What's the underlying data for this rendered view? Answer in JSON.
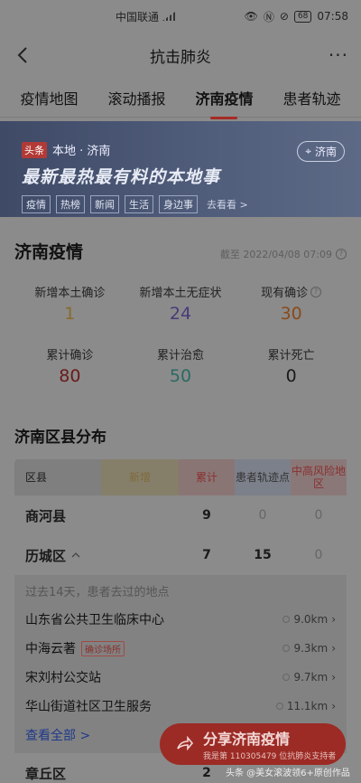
{
  "status": {
    "carrier": "中国联通",
    "time": "07:58",
    "battery": "68"
  },
  "appbar": {
    "title": "抗击肺炎"
  },
  "tabs": [
    {
      "label": "疫情地图"
    },
    {
      "label": "滚动播报"
    },
    {
      "label": "济南疫情"
    },
    {
      "label": "患者轨迹"
    }
  ],
  "banner": {
    "tag": "头条",
    "source": "本地 · 济南",
    "location": "济南",
    "headline": "最新最热最有料的本地事",
    "chips": [
      "疫情",
      "热榜",
      "新闻",
      "生活",
      "身边事"
    ],
    "goto": "去看看 >"
  },
  "summary": {
    "title": "济南疫情",
    "updated": "截至 2022/04/08 07:09",
    "stats": [
      {
        "label": "新增本土确诊",
        "value": "1",
        "color": "#8a6a2a"
      },
      {
        "label": "新增本土无症状",
        "value": "24",
        "color": "#4a3a7a"
      },
      {
        "label": "现有确诊",
        "value": "30",
        "color": "#8a4a1a"
      },
      {
        "label": "累计确诊",
        "value": "80",
        "color": "#6a1a1a"
      },
      {
        "label": "累计治愈",
        "value": "50",
        "color": "#2a6a66"
      },
      {
        "label": "累计死亡",
        "value": "0",
        "color": "#1a1a1a"
      }
    ]
  },
  "districts": {
    "title": "济南区县分布",
    "headers": {
      "district": "区县",
      "new": "新增",
      "total": "累计",
      "track": "患者轨迹点",
      "risk": "中高风险地区"
    },
    "rows": [
      {
        "district": "商河县",
        "new": "",
        "total": "9",
        "track": "0",
        "risk": "0"
      },
      {
        "district": "历城区",
        "new": "",
        "total": "7",
        "track": "15",
        "risk": "0"
      }
    ],
    "places_hint": "过去14天，患者去过的地点",
    "places": [
      {
        "name": "山东省公共卫生临床中心",
        "badge": "",
        "distance": "9.0km"
      },
      {
        "name": "中海云著",
        "badge": "确诊场所",
        "distance": "9.3km"
      },
      {
        "name": "宋刘村公交站",
        "badge": "",
        "distance": "9.7km"
      },
      {
        "name": "华山街道社区卫生服务",
        "badge": "",
        "distance": "11.1km"
      }
    ],
    "view_all": "查看全部 >",
    "last_row": {
      "district": "章丘区",
      "total": "2"
    }
  },
  "share": {
    "title": "分享济南疫情",
    "subtitle": "我是第 110305479 位抗肺炎支持者"
  },
  "watermark": "头条 @美女滚波领6+原创作品"
}
